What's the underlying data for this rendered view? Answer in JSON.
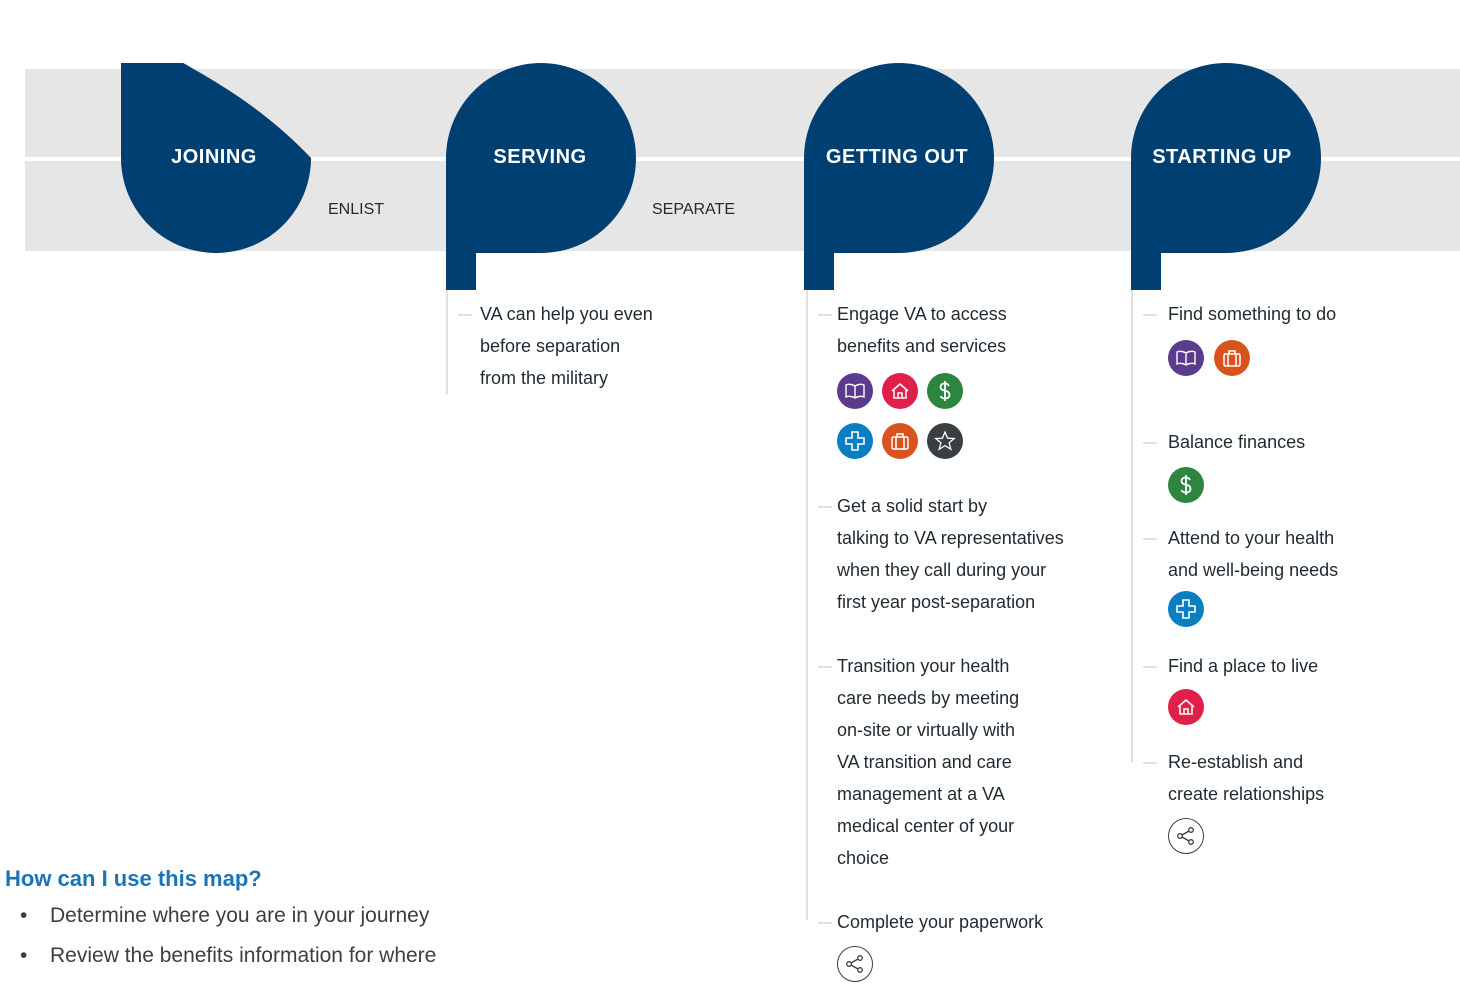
{
  "colors": {
    "drop": "#003f72",
    "band": "#e6e6e6",
    "education": "#5b3b8c",
    "housing": "#e0204a",
    "finance": "#2e8540",
    "health": "#0a7ec2",
    "careers": "#d9531e",
    "recognition": "#3a3f44",
    "help_title": "#1a74b8"
  },
  "stages": [
    {
      "title": "JOINING"
    },
    {
      "title": "SERVING"
    },
    {
      "title": "GETTING OUT"
    },
    {
      "title": "STARTING UP"
    }
  ],
  "transitions": [
    "ENLIST",
    "SEPARATE"
  ],
  "serving_items": [
    {
      "text": "VA can help you even\nbefore separation\nfrom the military"
    }
  ],
  "getting_out_items": [
    {
      "text": "Engage VA to access\nbenefits and services",
      "icons": [
        "book-icon",
        "home-icon",
        "dollar-icon",
        "health-cross-icon",
        "briefcase-icon",
        "star-icon"
      ]
    },
    {
      "text": "Get a solid start by\ntalking to VA representatives\nwhen they call during your\nfirst year post-separation",
      "icons": []
    },
    {
      "text": "Transition your health\ncare needs by meeting\non-site or virtually with\nVA transition and care\nmanagement at a VA\nmedical center of your\nchoice",
      "icons": []
    },
    {
      "text": "Complete your paperwork",
      "icons": [
        "share-icon"
      ]
    }
  ],
  "starting_up_items": [
    {
      "text": "Find something to do",
      "icons": [
        "book-icon",
        "briefcase-icon"
      ]
    },
    {
      "text": "Balance finances",
      "icons": [
        "dollar-icon"
      ]
    },
    {
      "text": "Attend to your health\nand well-being needs",
      "icons": [
        "health-cross-icon"
      ]
    },
    {
      "text": "Find a place to live",
      "icons": [
        "home-icon"
      ]
    },
    {
      "text": "Re-establish and\ncreate relationships",
      "icons": [
        "share-icon"
      ]
    }
  ],
  "help": {
    "title": "How can I use this map?",
    "bullets": [
      "Determine where you are in your journey",
      "Review the benefits information for where"
    ]
  }
}
